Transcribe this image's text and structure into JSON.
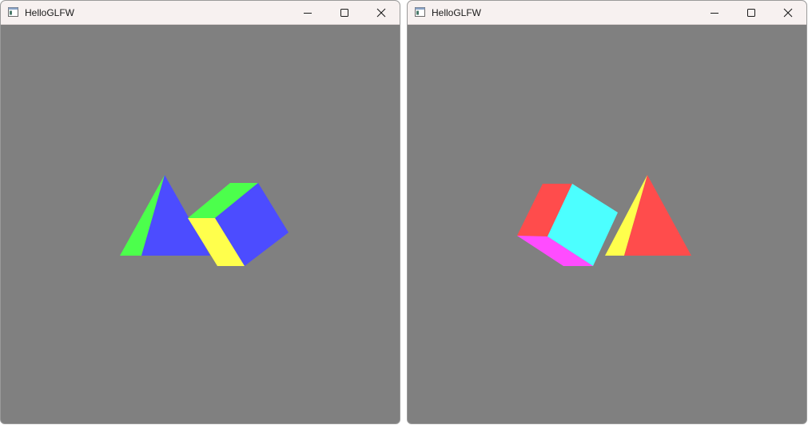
{
  "windows": [
    {
      "title": "HelloGLFW",
      "clear_color": "#808080",
      "scene": {
        "pyramid_colors": [
          "#4cff4c",
          "#4c4cff"
        ],
        "cube_colors": [
          "#4cff4c",
          "#4c4cff",
          "#ffff4c"
        ]
      }
    },
    {
      "title": "HelloGLFW",
      "clear_color": "#808080",
      "scene": {
        "pyramid_colors": [
          "#ffff4c",
          "#ff4c4c"
        ],
        "cube_colors": [
          "#ff4c4c",
          "#4cffff",
          "#ff4cff"
        ]
      }
    }
  ],
  "caption_buttons": [
    "minimize-icon",
    "maximize-icon",
    "close-icon"
  ],
  "titlebar_color": "#f7f1f0"
}
